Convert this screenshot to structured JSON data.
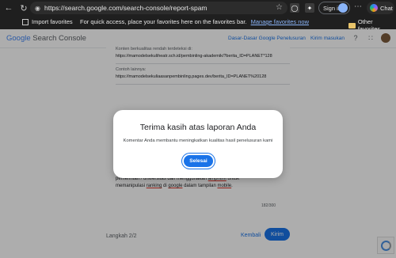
{
  "browser": {
    "url": "https://search.google.com/search-console/report-spam",
    "sign_in_label": "Sign in",
    "chat_label": "Chat",
    "favorites": {
      "import_label": "Import favorites",
      "message": "For quick access, place your favorites here on the favorites bar.",
      "manage_link": "Manage favorites now",
      "other_label": "Other favorites"
    }
  },
  "header": {
    "logo_google": "Google",
    "logo_product": "Search Console",
    "link_guidelines": "Dasar-Dasar Google Penelusuran",
    "link_feedback": "Kirim masukan"
  },
  "form": {
    "field1_label": "Konten berkualitas rendah terdeteksi di:",
    "field1_value": "https://mamodelsekuliheatr.sch.id/pembinling-akademik/?berita_ID=PLANET*128",
    "field2_label": "Contoh lainnya:",
    "field2_value": "https://mamodelsekuliaasanpembinling.pages.dev/berita_ID=PLANET%20128",
    "textarea_line1_a": "...",
    "textarea_line2_a": "pemerintah / universitas dan menggunakan ",
    "textarea_line2_u": "amphtml",
    "textarea_line2_b": " untuk",
    "textarea_line3_a": "memanipulasi ",
    "textarea_line3_u1": "ranking",
    "textarea_line3_b": " di ",
    "textarea_line3_u2": "google",
    "textarea_line3_c": " dalam tampilan ",
    "textarea_line3_u3": "mobile",
    "textarea_line3_d": ".",
    "char_counter": "182/300",
    "step_label": "Langkah 2/2",
    "back_label": "Kembali",
    "send_label": "Kirim"
  },
  "modal": {
    "title": "Terima kasih atas laporan Anda",
    "body": "Komentar Anda membantu meningkatkan kualitas hasil penelusuran kami",
    "done_label": "Selesai"
  }
}
